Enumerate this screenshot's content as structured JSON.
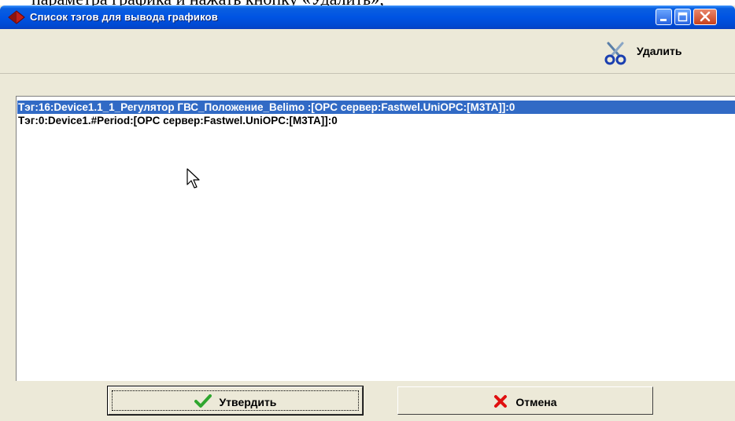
{
  "document": {
    "text_above": "параметра графика и нажать кнопку «Удалить»;"
  },
  "window": {
    "title": "Список тэгов для вывода графиков",
    "controls": [
      "minimize-icon",
      "maximize-icon",
      "close-icon"
    ]
  },
  "toolbar": {
    "delete_label": "Удалить",
    "delete_icon": "scissors-icon"
  },
  "tag_list": {
    "items": [
      {
        "text": "Тэг:16:Device1.1_1_Регулятор ГВС_Положение_Belimo :[OPC сервер:Fastwel.UniOPC:[M3TA]]:0",
        "selected": true
      },
      {
        "text": "Тэг:0:Device1.#Period:[OPC сервер:Fastwel.UniOPC:[M3TA]]:0",
        "selected": false
      }
    ]
  },
  "buttons": {
    "confirm_label": "Утвердить",
    "cancel_label": "Отмена"
  },
  "colors": {
    "titlebar": "#0054e3",
    "selection": "#316ac5",
    "window_bg": "#ece9d8",
    "confirm_icon": "#2fa62f",
    "cancel_icon": "#e01010"
  }
}
